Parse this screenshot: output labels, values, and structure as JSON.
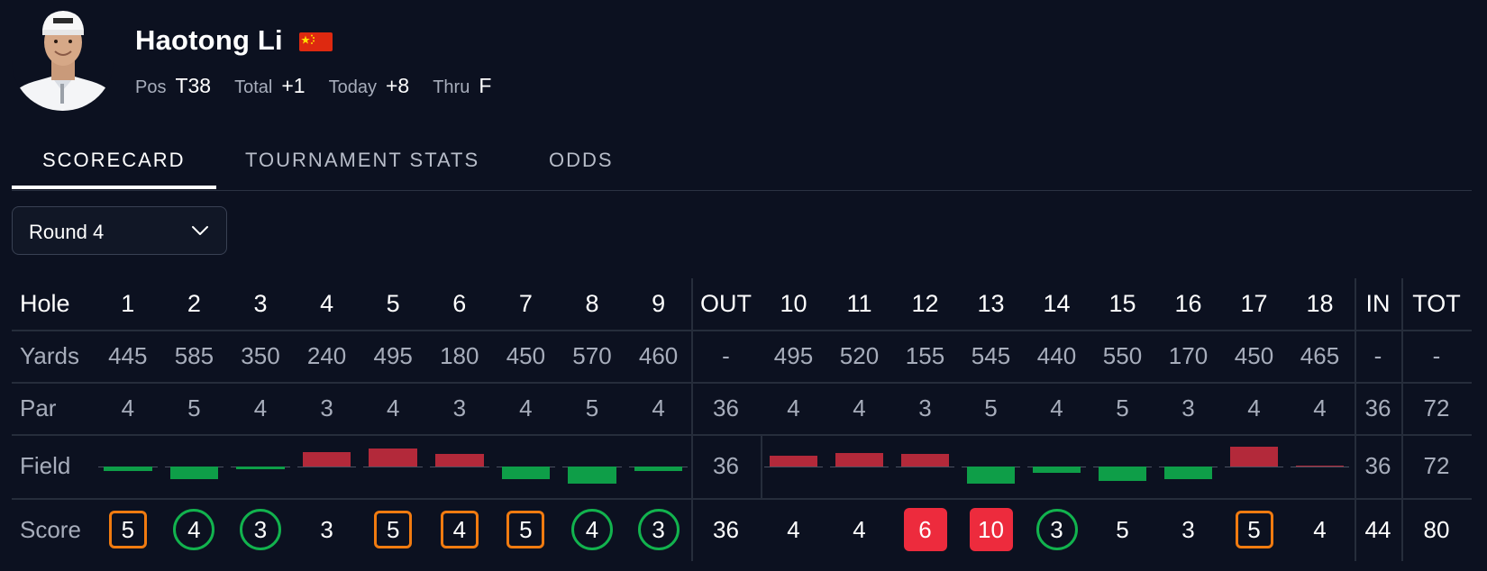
{
  "player": {
    "name": "Haotong Li",
    "flag_icon": "china-flag-icon",
    "stats": [
      {
        "label": "Pos",
        "value": "T38"
      },
      {
        "label": "Total",
        "value": "+1"
      },
      {
        "label": "Today",
        "value": "+8"
      },
      {
        "label": "Thru",
        "value": "F"
      }
    ]
  },
  "tabs": [
    "SCORECARD",
    "TOURNAMENT STATS",
    "ODDS"
  ],
  "active_tab": "SCORECARD",
  "round_select": {
    "value": "Round 4"
  },
  "scorecard": {
    "row_labels": {
      "hole": "Hole",
      "yards": "Yards",
      "par": "Par",
      "field": "Field",
      "score": "Score"
    },
    "out_label": "OUT",
    "in_label": "IN",
    "tot_label": "TOT",
    "front": {
      "holes": [
        "1",
        "2",
        "3",
        "4",
        "5",
        "6",
        "7",
        "8",
        "9"
      ],
      "yards": [
        "445",
        "585",
        "350",
        "240",
        "495",
        "180",
        "450",
        "570",
        "460"
      ],
      "par": [
        "4",
        "5",
        "4",
        "3",
        "4",
        "3",
        "4",
        "5",
        "4"
      ],
      "field_vs_par": [
        -0.08,
        -0.2,
        -0.04,
        0.24,
        0.3,
        0.2,
        -0.2,
        -0.28,
        -0.08
      ],
      "score": [
        "5",
        "4",
        "3",
        "3",
        "5",
        "4",
        "5",
        "4",
        "3"
      ],
      "score_type": [
        "bogey",
        "birdie",
        "birdie",
        "par",
        "bogey",
        "bogey",
        "bogey",
        "birdie",
        "birdie"
      ]
    },
    "out": {
      "yards": "-",
      "par": "36",
      "field": "36",
      "score": "36"
    },
    "back": {
      "holes": [
        "10",
        "11",
        "12",
        "13",
        "14",
        "15",
        "16",
        "17",
        "18"
      ],
      "yards": [
        "495",
        "520",
        "155",
        "545",
        "440",
        "550",
        "170",
        "450",
        "465"
      ],
      "par": [
        "4",
        "4",
        "3",
        "5",
        "4",
        "5",
        "3",
        "4",
        "4"
      ],
      "field_vs_par": [
        0.18,
        0.22,
        0.2,
        -0.28,
        -0.1,
        -0.24,
        -0.2,
        0.32,
        0.01
      ],
      "score": [
        "4",
        "4",
        "6",
        "10",
        "3",
        "5",
        "3",
        "5",
        "4"
      ],
      "score_type": [
        "par",
        "par",
        "double",
        "double",
        "birdie",
        "par",
        "par",
        "bogey",
        "par"
      ]
    },
    "in": {
      "yards": "-",
      "par": "36",
      "field": "36",
      "score": "44"
    },
    "tot": {
      "yards": "-",
      "par": "72",
      "field": "72",
      "score": "80"
    }
  },
  "colors": {
    "background": "#0c1120",
    "bogey": "#f17b10",
    "birdie": "#12b34e",
    "double_bogey": "#ed2b3d",
    "field_over": "#b3293a",
    "field_under": "#0e9e48"
  }
}
